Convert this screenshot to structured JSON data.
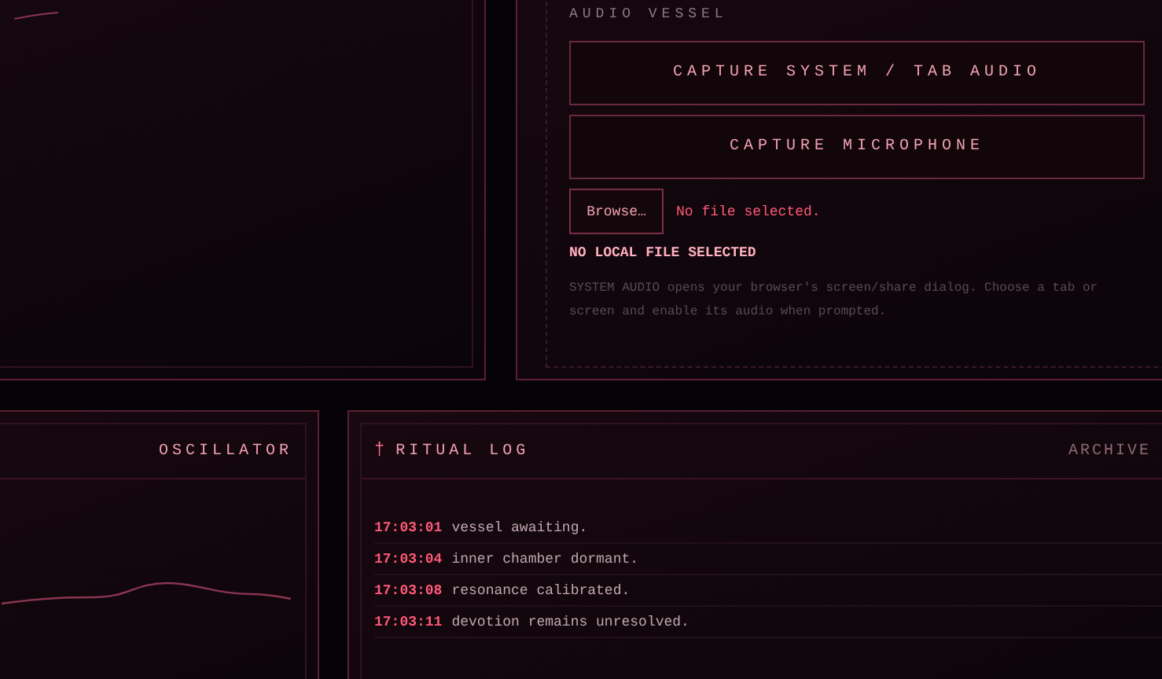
{
  "audio_vessel": {
    "title": "AUDIO VESSEL",
    "buttons": [
      {
        "label": "CAPTURE SYSTEM / TAB AUDIO"
      },
      {
        "label": "CAPTURE MICROPHONE"
      }
    ],
    "file_input": {
      "button": "Browse…",
      "status": "No file selected."
    },
    "local_status": "NO LOCAL FILE SELECTED",
    "help": "SYSTEM AUDIO opens your browser's screen/share dialog. Choose a tab or screen and enable its audio when prompted."
  },
  "oscillator": {
    "title": "OSCILLATOR"
  },
  "ritual_log": {
    "icon": "†",
    "title": "RITUAL LOG",
    "archive": "ARCHIVE",
    "entries": [
      {
        "time": "17:03:01",
        "message": "vessel awaiting."
      },
      {
        "time": "17:03:04",
        "message": "inner chamber dormant."
      },
      {
        "time": "17:03:08",
        "message": "resonance calibrated."
      },
      {
        "time": "17:03:11",
        "message": "devotion remains unresolved."
      }
    ]
  }
}
